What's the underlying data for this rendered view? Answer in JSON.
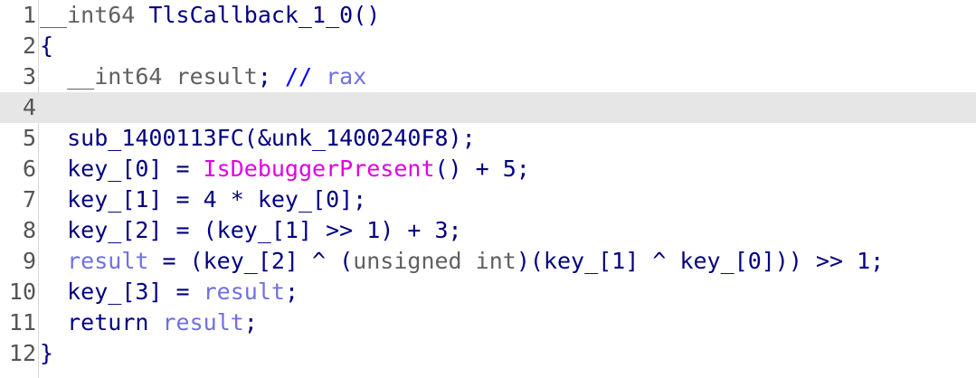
{
  "editor": {
    "lines": [
      {
        "number": "1",
        "tokens": [
          {
            "kind": "type",
            "text": "__int64"
          },
          {
            "kind": "plain",
            "text": " "
          },
          {
            "kind": "name",
            "text": "TlsCallback_1_0"
          },
          {
            "kind": "sym",
            "text": "()"
          }
        ]
      },
      {
        "number": "2",
        "tokens": [
          {
            "kind": "sym",
            "text": "{"
          }
        ]
      },
      {
        "number": "3",
        "tokens": [
          {
            "kind": "plain",
            "text": "  "
          },
          {
            "kind": "type",
            "text": "__int64"
          },
          {
            "kind": "plain",
            "text": " result"
          },
          {
            "kind": "sym",
            "text": ";"
          },
          {
            "kind": "plain",
            "text": " "
          },
          {
            "kind": "comment",
            "text": "// "
          },
          {
            "kind": "var",
            "text": "rax"
          }
        ]
      },
      {
        "number": "4",
        "highlighted": true,
        "tokens": []
      },
      {
        "number": "5",
        "tokens": [
          {
            "kind": "plain",
            "text": "  "
          },
          {
            "kind": "name",
            "text": "sub_1400113FC(&unk_1400240F8);"
          }
        ]
      },
      {
        "number": "6",
        "tokens": [
          {
            "kind": "plain",
            "text": "  "
          },
          {
            "kind": "name",
            "text": "key_[0] = "
          },
          {
            "kind": "import",
            "text": "IsDebuggerPresent"
          },
          {
            "kind": "name",
            "text": "() + 5;"
          }
        ]
      },
      {
        "number": "7",
        "tokens": [
          {
            "kind": "plain",
            "text": "  "
          },
          {
            "kind": "name",
            "text": "key_[1] = 4 * key_[0];"
          }
        ]
      },
      {
        "number": "8",
        "tokens": [
          {
            "kind": "plain",
            "text": "  "
          },
          {
            "kind": "name",
            "text": "key_[2] = (key_[1] >> 1) + 3;"
          }
        ]
      },
      {
        "number": "9",
        "tokens": [
          {
            "kind": "plain",
            "text": "  "
          },
          {
            "kind": "var",
            "text": "result"
          },
          {
            "kind": "name",
            "text": " = (key_[2] ^ ("
          },
          {
            "kind": "type",
            "text": "unsigned int"
          },
          {
            "kind": "name",
            "text": ")(key_[1] ^ key_[0])) >> 1;"
          }
        ]
      },
      {
        "number": "10",
        "tokens": [
          {
            "kind": "plain",
            "text": "  "
          },
          {
            "kind": "name",
            "text": "key_[3] = "
          },
          {
            "kind": "var",
            "text": "result"
          },
          {
            "kind": "name",
            "text": ";"
          }
        ]
      },
      {
        "number": "11",
        "tokens": [
          {
            "kind": "plain",
            "text": "  "
          },
          {
            "kind": "kw",
            "text": "return"
          },
          {
            "kind": "plain",
            "text": " "
          },
          {
            "kind": "var",
            "text": "result"
          },
          {
            "kind": "name",
            "text": ";"
          }
        ]
      },
      {
        "number": "12",
        "tokens": [
          {
            "kind": "sym",
            "text": "}"
          }
        ]
      }
    ],
    "colors": {
      "highlight": "#e6e6e6",
      "identifier": "#000080",
      "type": "#606060",
      "variable": "#7070e0",
      "import": "#e000e0",
      "comment": "#0000ff"
    }
  }
}
